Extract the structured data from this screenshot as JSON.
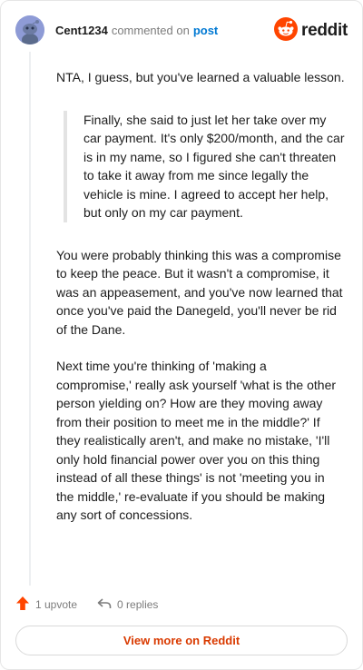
{
  "header": {
    "username": "Cent1234",
    "action": "commented on",
    "target": "post",
    "brand": "reddit",
    "avatar_icon": "snoo-avatar-icon",
    "brand_icon": "reddit-logo-icon"
  },
  "comment": {
    "paragraph_1": "NTA, I guess, but you've learned a valuable lesson.",
    "quote": "Finally, she said to just let her take over my car payment. It's only $200/month, and the car is in my name, so I figured she can't threaten to take it away from me since legally the vehicle is mine. I agreed to accept her help, but only on my car payment.",
    "paragraph_2": "You were probably thinking this was a compromise to keep the peace. But it wasn't a compromise, it was an appeasement, and you've now learned that once you've paid the Danegeld, you'll never be rid of the Dane.",
    "paragraph_3": "Next time you're thinking of 'making a compromise,' really ask yourself 'what is the other person yielding on? How are they moving away from their position to meet me in the middle?' If they realistically aren't, and make no mistake, 'I'll only hold financial power over you on this thing instead of all these things' is not 'meeting you in the middle,' re-evaluate if you should be making any sort of concessions."
  },
  "footer": {
    "upvotes": "1 upvote",
    "replies": "0 replies",
    "upvote_icon": "upvote-arrow-icon",
    "reply_icon": "reply-arrow-icon"
  },
  "view_button": "View more on Reddit",
  "colors": {
    "accent": "#ff4500",
    "link": "#0079d3",
    "button_text": "#d93a00"
  }
}
